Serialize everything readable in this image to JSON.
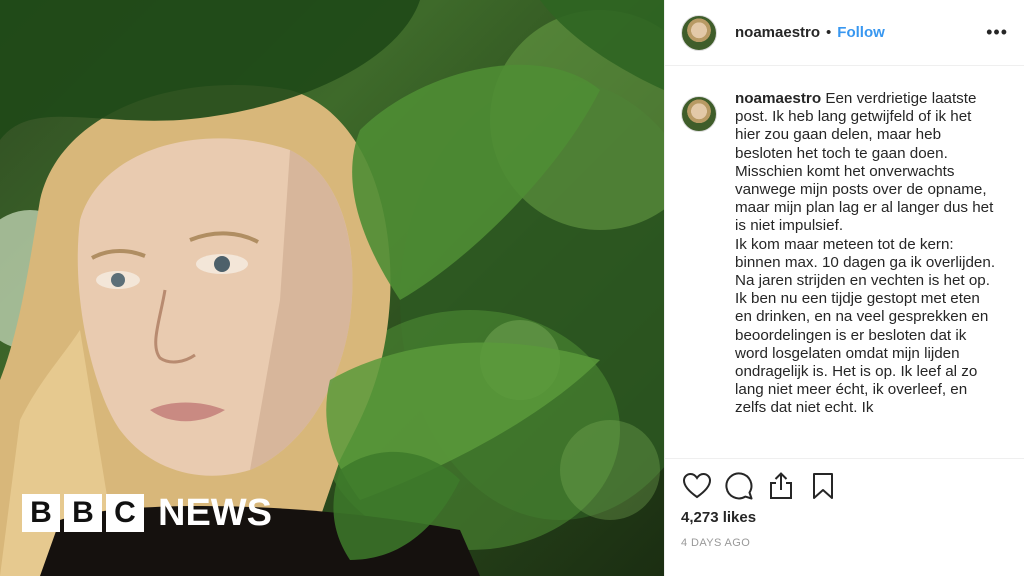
{
  "watermark": {
    "letters": [
      "B",
      "B",
      "C"
    ],
    "word": "NEWS"
  },
  "post": {
    "username": "noamaestro",
    "separator": "•",
    "follow_label": "Follow",
    "more_label": "•••",
    "caption": "Een verdrietige laatste post. Ik heb lang getwijfeld of ik het hier zou gaan delen, maar heb besloten het toch te gaan doen. Misschien komt het onverwachts vanwege mijn posts over de opname, maar mijn plan lag er al langer dus het is niet impulsief.\nIk kom maar meteen tot de kern: binnen max. 10 dagen ga ik overlijden. Na jaren strijden en vechten is het op. Ik ben nu een tijdje gestopt met eten en drinken, en na veel gesprekken en beoordelingen is er besloten dat ik word losgelaten omdat mijn lijden ondragelijk is. Het is op. Ik leef al zo lang niet meer écht, ik overleef, en zelfs dat niet echt. Ik",
    "likes": "4,273 likes",
    "timestamp": "4 DAYS AGO"
  },
  "icons": {
    "like": "heart-icon",
    "comment": "comment-bubble-icon",
    "share": "share-icon",
    "save": "bookmark-icon"
  },
  "colors": {
    "link_blue": "#3897f0",
    "text": "#262626",
    "muted": "#999999"
  }
}
